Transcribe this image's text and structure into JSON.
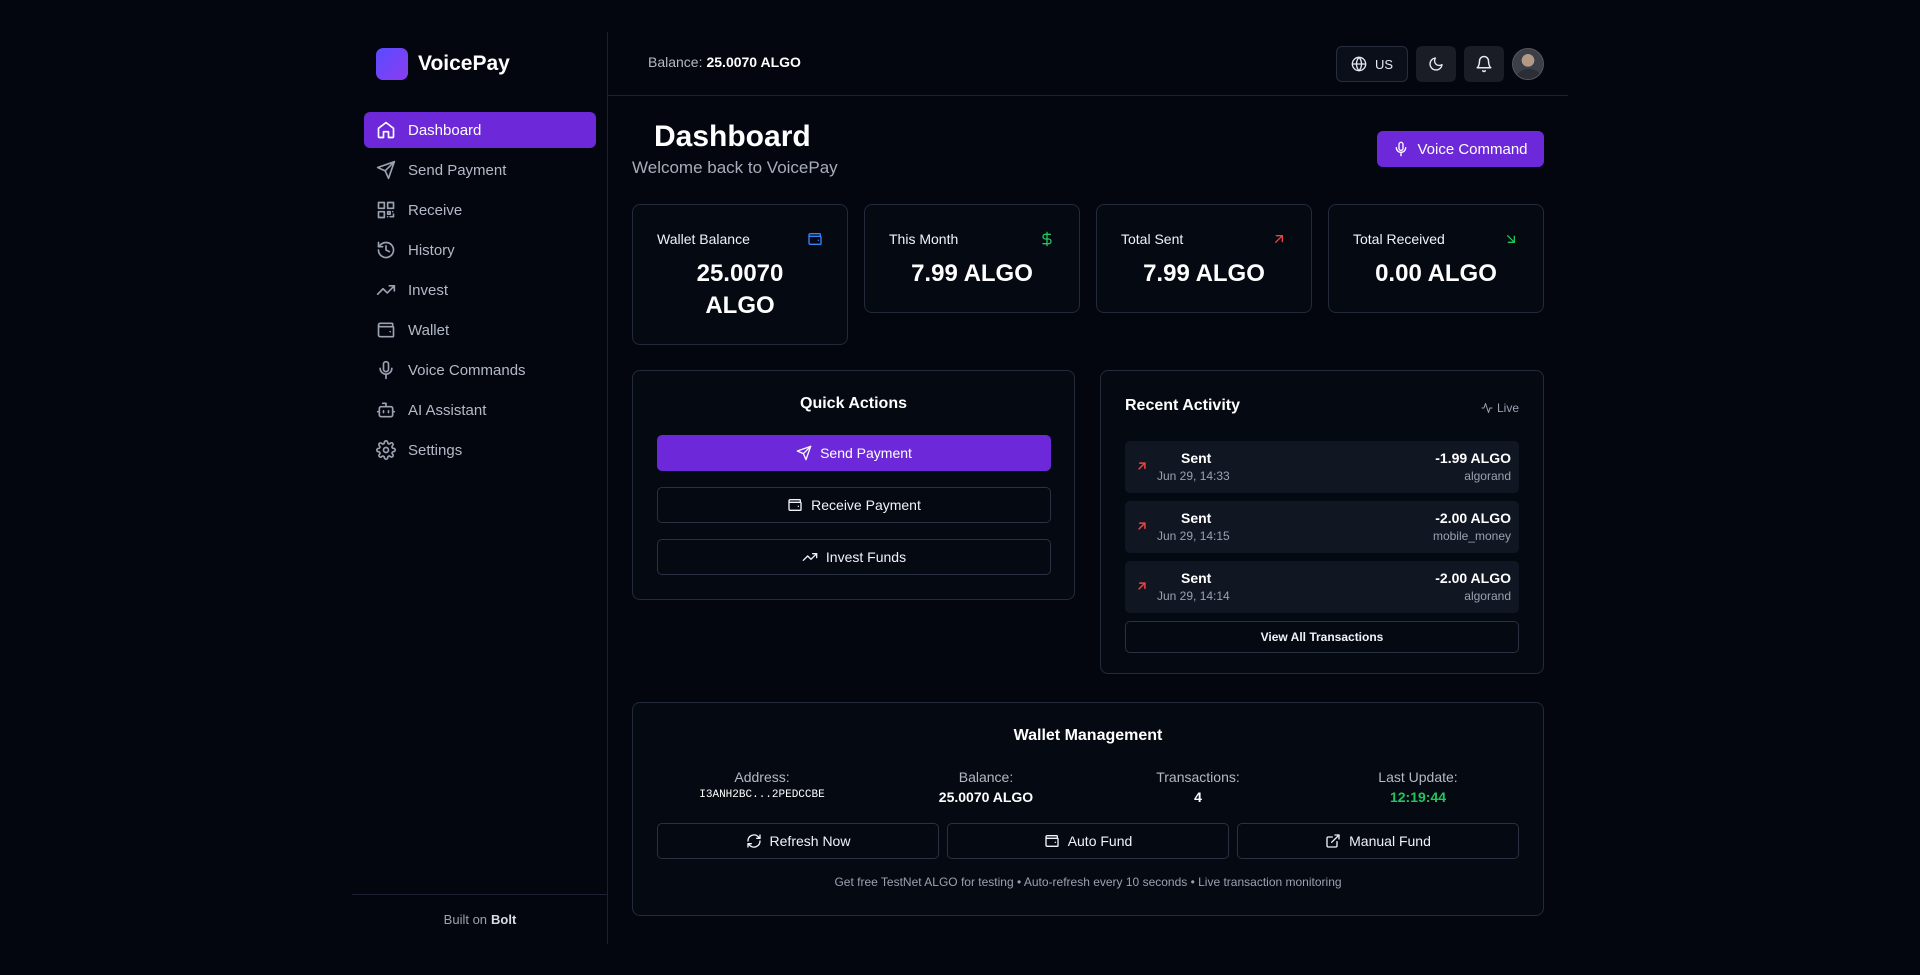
{
  "app": {
    "name": "VoicePay",
    "footer_prefix": "Built on",
    "footer_brand": "Bolt"
  },
  "sidebar": {
    "items": [
      {
        "label": "Dashboard",
        "icon": "home-icon",
        "active": true
      },
      {
        "label": "Send Payment",
        "icon": "send-icon"
      },
      {
        "label": "Receive",
        "icon": "qr-code-icon"
      },
      {
        "label": "History",
        "icon": "history-icon"
      },
      {
        "label": "Invest",
        "icon": "trending-up-icon"
      },
      {
        "label": "Wallet",
        "icon": "wallet-icon"
      },
      {
        "label": "Voice Commands",
        "icon": "mic-icon"
      },
      {
        "label": "AI Assistant",
        "icon": "bot-icon"
      },
      {
        "label": "Settings",
        "icon": "gear-icon"
      }
    ]
  },
  "topbar": {
    "balance_label": "Balance:",
    "balance_value": "25.0070 ALGO",
    "language": "US"
  },
  "header": {
    "title": "Dashboard",
    "subtitle": "Welcome back to VoicePay",
    "voice_button": "Voice Command"
  },
  "stats": [
    {
      "label": "Wallet Balance",
      "value": "25.0070 ALGO",
      "icon": "wallet-icon",
      "color": "#3b82f6"
    },
    {
      "label": "This Month",
      "value": "7.99 ALGO",
      "icon": "dollar-icon",
      "color": "#22c55e"
    },
    {
      "label": "Total Sent",
      "value": "7.99 ALGO",
      "icon": "arrow-up-right-icon",
      "color": "#ef4444"
    },
    {
      "label": "Total Received",
      "value": "0.00 ALGO",
      "icon": "arrow-down-right-icon",
      "color": "#22c55e"
    }
  ],
  "quick_actions": {
    "title": "Quick Actions",
    "send": "Send Payment",
    "receive": "Receive Payment",
    "invest": "Invest Funds"
  },
  "recent_activity": {
    "title": "Recent Activity",
    "live": "Live",
    "items": [
      {
        "type": "Sent",
        "date": "Jun 29, 14:33",
        "amount": "-1.99 ALGO",
        "network": "algorand"
      },
      {
        "type": "Sent",
        "date": "Jun 29, 14:15",
        "amount": "-2.00 ALGO",
        "network": "mobile_money"
      },
      {
        "type": "Sent",
        "date": "Jun 29, 14:14",
        "amount": "-2.00 ALGO",
        "network": "algorand"
      }
    ],
    "view_all": "View All Transactions"
  },
  "wallet_management": {
    "title": "Wallet Management",
    "address_label": "Address:",
    "address_value": "I3ANH2BC...2PEDCCBE",
    "balance_label": "Balance:",
    "balance_value": "25.0070 ALGO",
    "tx_label": "Transactions:",
    "tx_value": "4",
    "update_label": "Last Update:",
    "update_value": "12:19:44",
    "refresh": "Refresh Now",
    "auto_fund": "Auto Fund",
    "manual_fund": "Manual Fund",
    "note": "Get free TestNet ALGO for testing • Auto-refresh every 10 seconds • Live transaction monitoring"
  },
  "colors": {
    "accent": "#6d28d9",
    "positive": "#22c55e",
    "negative": "#ef4444",
    "info": "#3b82f6"
  }
}
